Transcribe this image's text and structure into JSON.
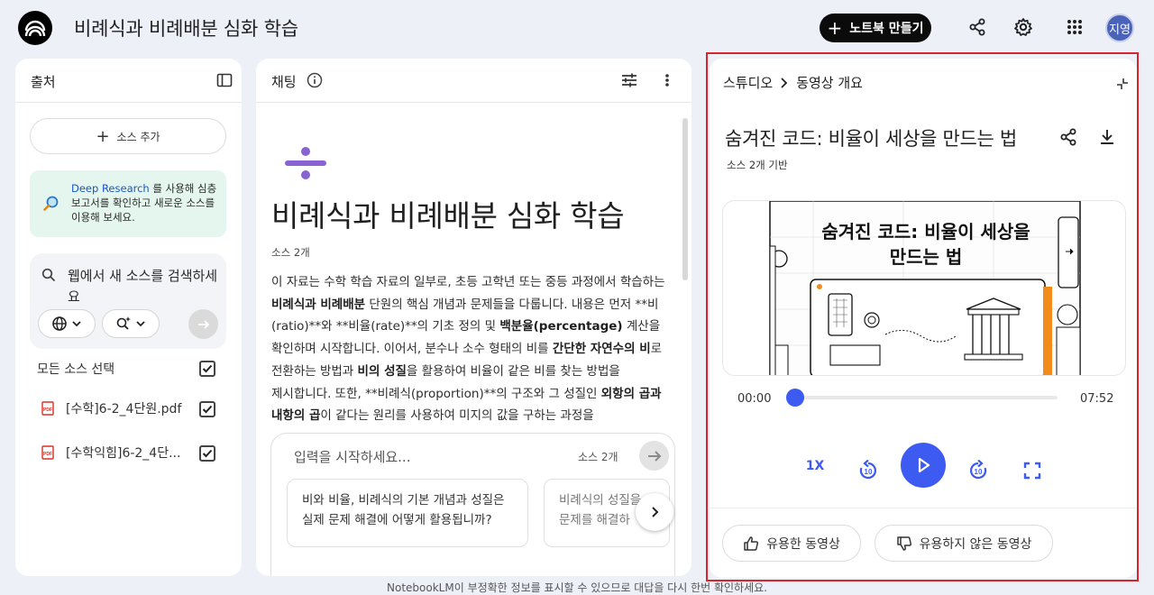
{
  "header": {
    "title": "비례식과 비례배분 심화 학습",
    "new_notebook_label": "노트북 만들기",
    "avatar_initials": "지영"
  },
  "sources": {
    "title": "출처",
    "add_source_label": "소스 추가",
    "deep_research_link": "Deep Research",
    "deep_research_text": " 를 사용해 심층 보고서를 확인하고 새로운 소스를 이용해 보세요.",
    "search_placeholder": "웹에서 새 소스를 검색하세요",
    "select_all_label": "모든 소스 선택",
    "items": [
      {
        "name": "[수학]6-2_4단원.pdf",
        "checked": true
      },
      {
        "name": "[수학익힘]6-2_4단...",
        "checked": true
      }
    ]
  },
  "chat": {
    "title": "채팅",
    "heading": "비례식과 비례배분 심화 학습",
    "source_count": "소스 2개",
    "composer_placeholder": "입력을 시작하세요...",
    "composer_count": "소스 2개",
    "suggestions": [
      "비와 비율, 비례식의 기본 개념과 성질은 실제 문제 해결에 어떻게 활용됩니까?",
      "비례식의 성질을 문제를 해결하"
    ]
  },
  "studio": {
    "breadcrumb_root": "스튜디오",
    "breadcrumb_current": "동영상 개요",
    "video_title": "숨겨진 코드: 비율이 세상을 만드는 법",
    "video_subtitle": "소스 2개 기반",
    "thumbnail_title": "숨겨진 코드: 비율이 세상을 만드는 법",
    "time_current": "00:00",
    "time_total": "07:52",
    "progress": 0,
    "speed_label": "1X",
    "like_label": "유용한 동영상",
    "dislike_label": "유용하지 않은 동영상",
    "accent_color": "#3d5af1",
    "highlight_color": "#d9232e"
  },
  "footer_text": "NotebookLM이 부정확한 정보를 표시할 수 있으므로 대답을 다시 한번 확인하세요."
}
